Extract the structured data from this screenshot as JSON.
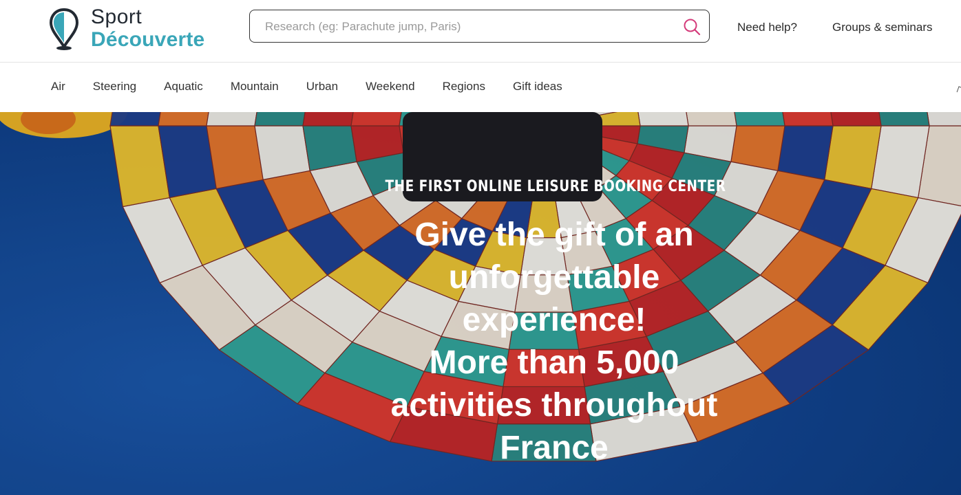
{
  "brand": {
    "name_line1": "Sport",
    "name_line2": "Découverte",
    "colors": {
      "dark": "#232a33",
      "accent": "#3aa6b8",
      "search_icon": "#d43b7a"
    }
  },
  "header": {
    "search": {
      "placeholder": "Research (eg: Parachute jump, Paris)",
      "value": "",
      "icon": "search-icon"
    },
    "links": {
      "help": "Need help?",
      "groups": "Groups & seminars"
    }
  },
  "nav": {
    "items": [
      "Air",
      "Steering",
      "Aquatic",
      "Mountain",
      "Urban",
      "Weekend",
      "Regions",
      "Gift ideas"
    ]
  },
  "hero": {
    "kicker": "THE FIRST ONLINE LEISURE BOOKING CENTER",
    "headline_lines": [
      "Give the gift of an",
      "unforgettable",
      "experience!",
      "More than 5,000",
      "activities throughout",
      "France"
    ]
  }
}
